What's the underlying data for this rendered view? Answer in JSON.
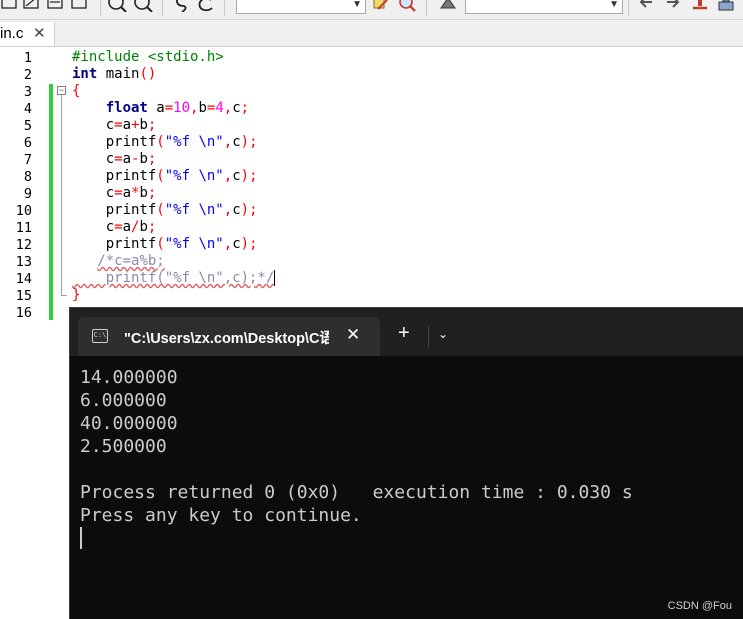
{
  "toolbar": {
    "icons": [
      "select-icon",
      "select-icon",
      "select-icon",
      "zoom-in-icon",
      "zoom-out-icon",
      "replace-icon",
      "case-icon",
      "edit-icon",
      "search-icon",
      "run-icon",
      "back-icon",
      "forward-icon",
      "stop-icon",
      "debug-icon"
    ],
    "combo1_value": "",
    "combo2_value": ""
  },
  "editor": {
    "tab": {
      "label": "in.c",
      "close": "✕"
    },
    "line_numbers": [
      "1",
      "2",
      "3",
      "4",
      "5",
      "6",
      "7",
      "8",
      "9",
      "10",
      "11",
      "12",
      "13",
      "14",
      "15",
      "16"
    ],
    "lines": [
      "#include <stdio.h>",
      "int main()",
      "{",
      "    float a=10,b=4,c;",
      "    c=a+b;",
      "    printf(\"%f \\n\",c);",
      "    c=a-b;",
      "    printf(\"%f \\n\",c);",
      "    c=a*b;",
      "    printf(\"%f \\n\",c);",
      "    c=a/b;",
      "    printf(\"%f \\n\",c);",
      "   /*c=a%b;",
      "    printf(\"%f \\n\",c);*/",
      "}",
      ""
    ],
    "fold_marker": "−"
  },
  "terminal": {
    "title": "\"C:\\Users\\zx.com\\Desktop\\C语",
    "icon_text": "C:\\",
    "close": "✕",
    "new_tab": "+",
    "dropdown": "⌄",
    "output": [
      "14.000000",
      "6.000000",
      "40.000000",
      "2.500000",
      "",
      "Process returned 0 (0x0)   execution time : 0.030 s",
      "Press any key to continue."
    ]
  },
  "watermark": "CSDN @Fou",
  "colors": {
    "keyword": "#000080",
    "preprocessor": "#008000",
    "number": "#ff00ff",
    "operator": "#ff0000",
    "string": "#0000ff",
    "comment": "#8a8aa8",
    "change_bar": "#2ecc40",
    "terminal_bg": "#0c0c0c",
    "terminal_text": "#cccccc"
  }
}
